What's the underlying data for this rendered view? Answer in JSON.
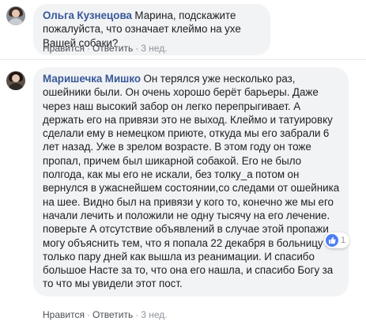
{
  "comments": [
    {
      "author": "Ольга Кузнецова",
      "text": "Марина, подскажите пожалуйста, что означает клеймо на ухе Вашей собаки?",
      "like_label": "Нравится",
      "reply_label": "Ответить",
      "time": "3 нед."
    },
    {
      "author": "Маришечка Мишко",
      "text": "Он терялся уже несколько раз, ошейники были. Он очень хорошо берёт барьеры. Даже через наш высокий забор он легко перепрыгивает. А держать его на привязи это не выход. Клеймо и татуировку сделали ему в немецком приюте, откуда мы его забрали 6 лет назад. Уже в зрелом возрасте. В этом году он тоже пропал, причем был шикарной собакой. Его не было полгода, как мы его не искали, без толку_а потом он вернулся в ужаснейшем состоянии,со следами от ошейника на шее. Видно был на привязи у кого то, конечно же мы его начали лечить и положили не одну тысячу на его лечение. поверьте А отсутствие объявлений в случае этой пропажи могу объяснить тем, что я попала 22 декабря в больницу и только пару дней как вышла из реанимации. И спасибо большое Насте за то, что она его нашла, и спасибо Богу за то что мы увидели этот пост.",
      "like_label": "Нравится",
      "reply_label": "Ответить",
      "time": "3 нед.",
      "reaction_count": "1",
      "reaction_icon": "like-icon"
    }
  ],
  "separator": "·",
  "colors": {
    "author": "#385898",
    "bubble": "#f2f3f5",
    "meta": "#90949c",
    "like_badge": "#4c7ef3"
  }
}
